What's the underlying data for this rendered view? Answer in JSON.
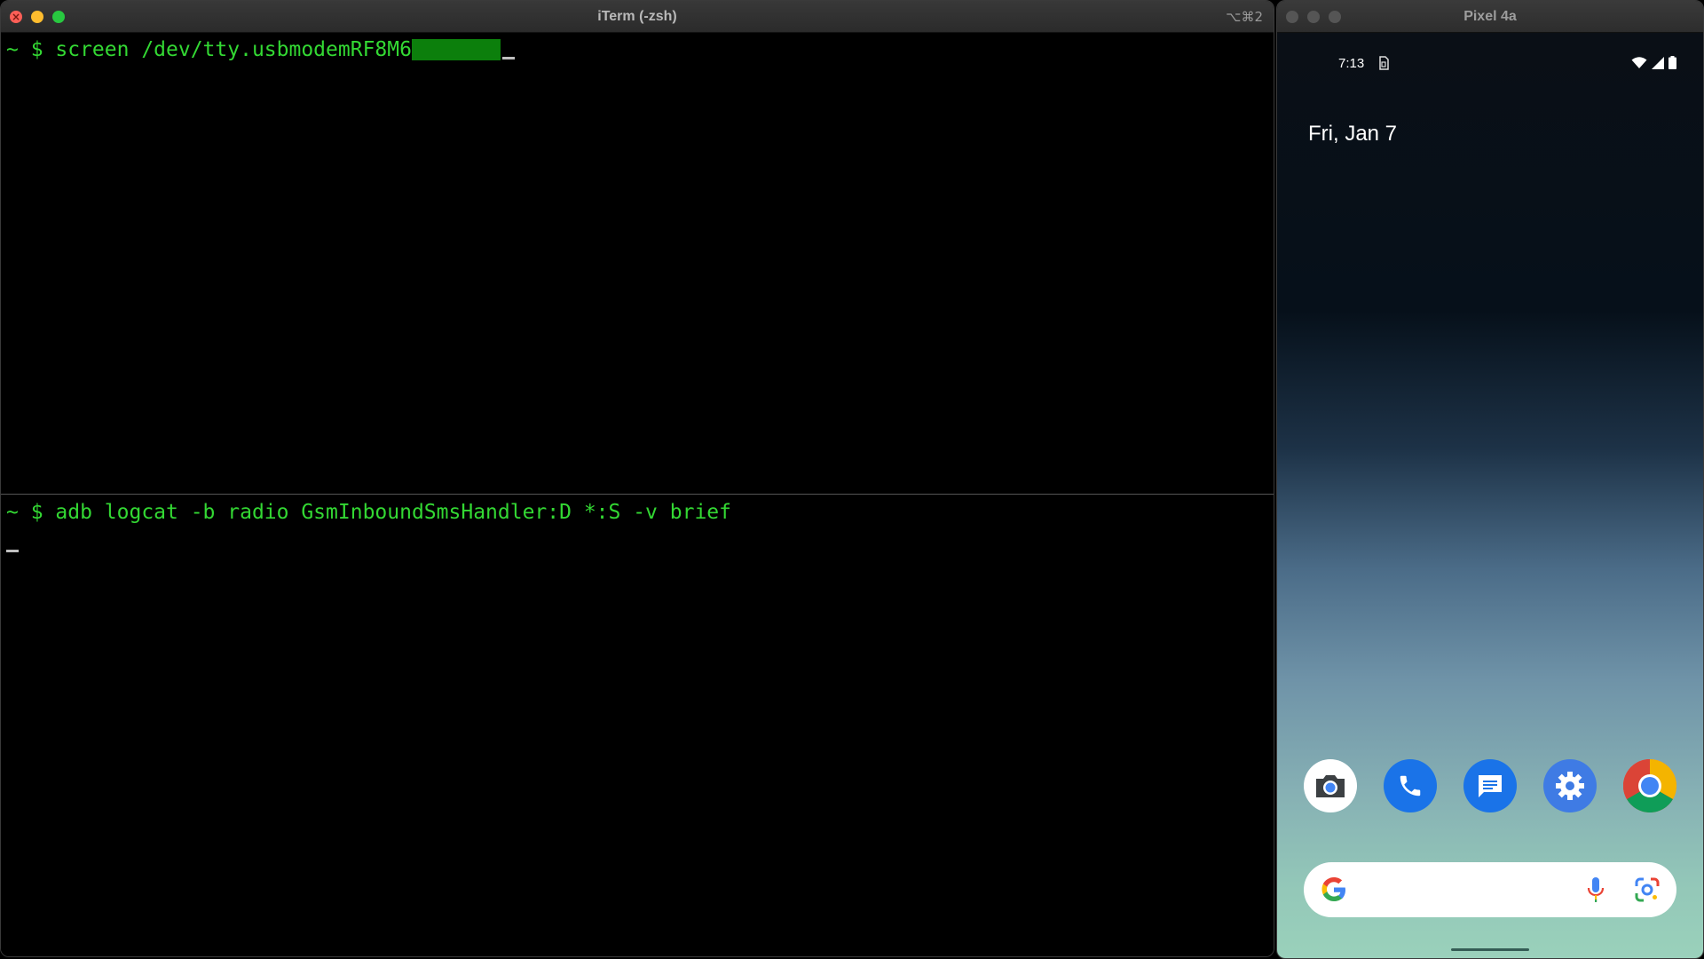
{
  "iterm": {
    "title": "iTerm (-zsh)",
    "shortcut": "⌥⌘2",
    "top_pane": {
      "prompt": "~ $ ",
      "command": "screen /dev/tty.usbmodemRF8M6"
    },
    "bottom_pane": {
      "prompt": "~ $ ",
      "command": "adb logcat -b radio GsmInboundSmsHandler:D *:S -v brief"
    }
  },
  "emulator": {
    "title": "Pixel 4a",
    "status_bar": {
      "time": "7:13",
      "notification_icon": "sim-icon",
      "icons": [
        "wifi-icon",
        "signal-icon",
        "battery-icon"
      ]
    },
    "date": "Fri, Jan 7",
    "dock": [
      {
        "name": "camera-app-icon",
        "color": "#ffffff"
      },
      {
        "name": "phone-app-icon",
        "color": "#1a73e8"
      },
      {
        "name": "messages-app-icon",
        "color": "#1a73e8"
      },
      {
        "name": "settings-app-icon",
        "color": "#3f7be4"
      },
      {
        "name": "chrome-app-icon",
        "color": "#ffffff"
      }
    ],
    "search_bar": {
      "logo": "google-g-icon",
      "mic": "mic-icon",
      "lens": "lens-icon"
    }
  },
  "colors": {
    "terminal_text": "#33d833",
    "terminal_bg": "#000000",
    "redaction": "#0c7f0c"
  }
}
